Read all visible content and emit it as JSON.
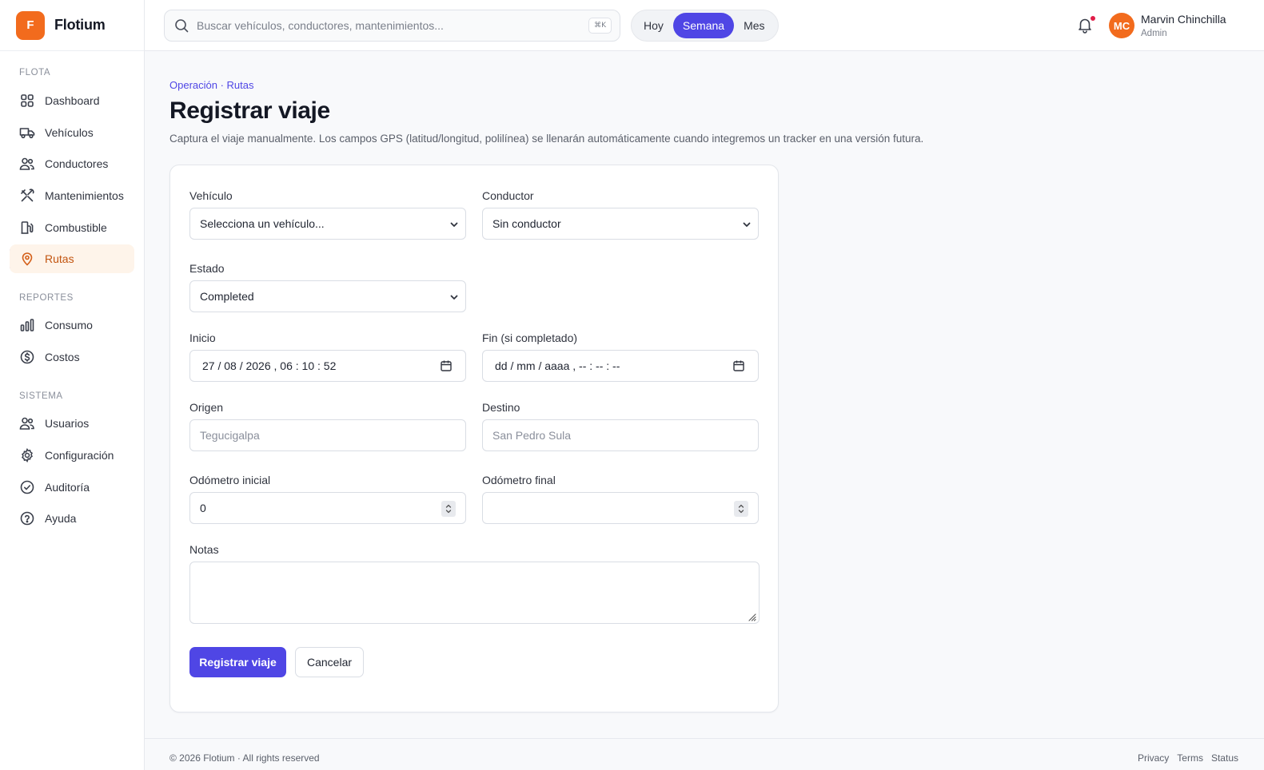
{
  "brand": {
    "initial": "F",
    "name": "Flotium"
  },
  "sidebar": {
    "sections": [
      {
        "title": "FLOTA",
        "items": [
          {
            "label": "Dashboard",
            "icon": "grid-icon"
          },
          {
            "label": "Vehículos",
            "icon": "truck-icon"
          },
          {
            "label": "Conductores",
            "icon": "users-icon"
          },
          {
            "label": "Mantenimientos",
            "icon": "wrench-icon"
          },
          {
            "label": "Combustible",
            "icon": "fuel-icon"
          },
          {
            "label": "Rutas",
            "icon": "map-pin-icon",
            "active": true
          }
        ]
      },
      {
        "title": "REPORTES",
        "items": [
          {
            "label": "Consumo",
            "icon": "bar-chart-icon"
          },
          {
            "label": "Costos",
            "icon": "dollar-circle-icon"
          }
        ]
      },
      {
        "title": "SISTEMA",
        "items": [
          {
            "label": "Usuarios",
            "icon": "users-icon"
          },
          {
            "label": "Configuración",
            "icon": "gear-icon"
          },
          {
            "label": "Auditoría",
            "icon": "check-circle-icon"
          },
          {
            "label": "Ayuda",
            "icon": "help-circle-icon"
          }
        ]
      }
    ]
  },
  "topbar": {
    "search_placeholder": "Buscar vehículos, conductores, mantenimientos...",
    "shortcut": "⌘K",
    "periods": [
      {
        "label": "Hoy",
        "active": false
      },
      {
        "label": "Semana",
        "active": true
      },
      {
        "label": "Mes",
        "active": false
      }
    ],
    "user": {
      "initials": "MC",
      "name": "Marvin Chinchilla",
      "role": "Admin"
    }
  },
  "page": {
    "breadcrumb": "Operación · Rutas",
    "title": "Registrar viaje",
    "description": "Captura el viaje manualmente. Los campos GPS (latitud/longitud, polilínea) se llenarán automáticamente cuando integremos un tracker en una versión futura."
  },
  "form": {
    "vehicle_label": "Vehículo",
    "vehicle_value": "Selecciona un vehículo...",
    "driver_label": "Conductor",
    "driver_value": "Sin conductor",
    "status_label": "Estado",
    "status_value": "Completed",
    "start_label": "Inicio",
    "start_value": "27 / 08 / 2026 ,  06 : 10 : 52",
    "end_label": "Fin (si completado)",
    "end_value": "dd / mm / aaaa ,  -- : -- : --",
    "origin_label": "Origen",
    "origin_placeholder": "Tegucigalpa",
    "destination_label": "Destino",
    "destination_placeholder": "San Pedro Sula",
    "odo_start_label": "Odómetro inicial",
    "odo_start_value": "0",
    "odo_end_label": "Odómetro final",
    "odo_end_value": "",
    "notes_label": "Notas",
    "submit_label": "Registrar viaje",
    "cancel_label": "Cancelar"
  },
  "footer": {
    "copyright": "© 2026 Flotium · All rights reserved",
    "links": [
      "Privacy",
      "Terms",
      "Status"
    ]
  },
  "colors": {
    "brand": "#f26b1d",
    "accent": "#4f46e5",
    "active_bg": "#fef4ea",
    "notification": "#e11d48"
  }
}
